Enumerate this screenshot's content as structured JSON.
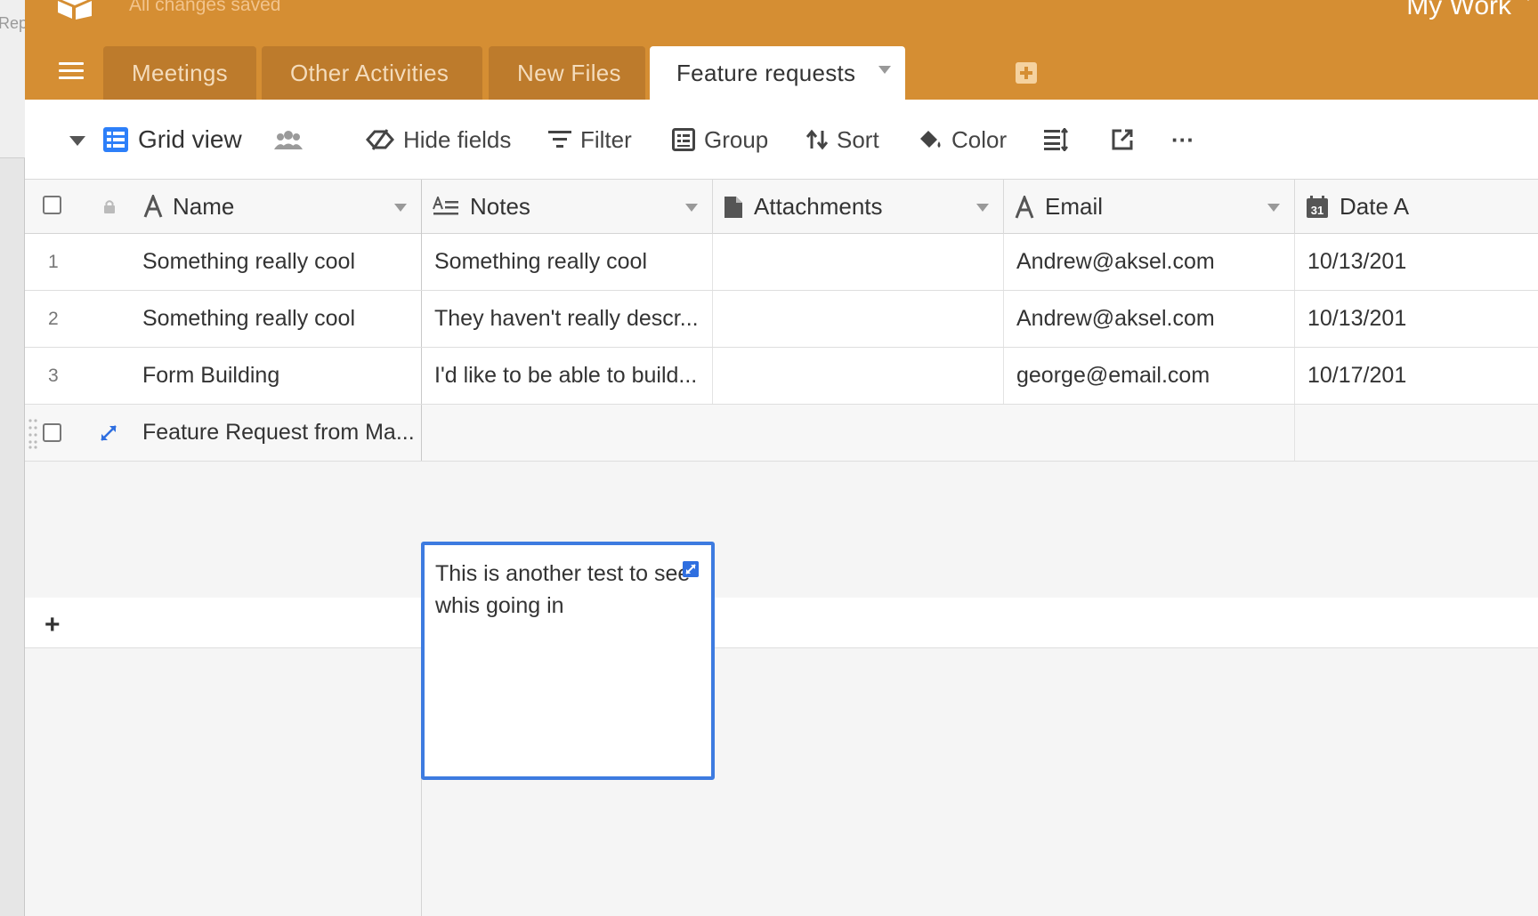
{
  "window": {
    "sliver_text": "Rep"
  },
  "header": {
    "save_status": "All changes saved",
    "base_name": "My Work"
  },
  "tabs": [
    {
      "label": "Meetings",
      "active": false
    },
    {
      "label": "Other Activities",
      "active": false
    },
    {
      "label": "New Files",
      "active": false
    },
    {
      "label": "Feature requests",
      "active": true
    }
  ],
  "toolbar": {
    "view_name": "Grid view",
    "hide_fields": "Hide fields",
    "filter": "Filter",
    "group": "Group",
    "sort": "Sort",
    "color": "Color",
    "more": "···"
  },
  "columns": [
    {
      "label": "Name",
      "icon": "text-icon"
    },
    {
      "label": "Notes",
      "icon": "long-text-icon"
    },
    {
      "label": "Attachments",
      "icon": "attachment-icon"
    },
    {
      "label": "Email",
      "icon": "text-icon"
    },
    {
      "label": "Date A",
      "icon": "calendar-icon",
      "icon_text": "31"
    }
  ],
  "rows": [
    {
      "num": "1",
      "name": "Something really cool",
      "notes": "Something really cool",
      "attachments": "",
      "email": "Andrew@aksel.com",
      "date": "10/13/201"
    },
    {
      "num": "2",
      "name": "Something really cool",
      "notes": "They haven't really descr...",
      "attachments": "",
      "email": "Andrew@aksel.com",
      "date": "10/13/201"
    },
    {
      "num": "3",
      "name": "Form Building",
      "notes": "I'd like to be able to build...",
      "attachments": "",
      "email": "george@email.com",
      "date": "10/17/201"
    },
    {
      "num": "",
      "name": "Feature Request from Ma...",
      "notes": "This is another test to see whis going in",
      "attachments": "",
      "email": "",
      "date": ""
    }
  ],
  "add_row": "+",
  "colors": {
    "header": "#d58e33",
    "tab_inactive": "#bd7b2c",
    "accent_blue": "#3d7be0",
    "view_icon_blue": "#2d7ff9"
  }
}
